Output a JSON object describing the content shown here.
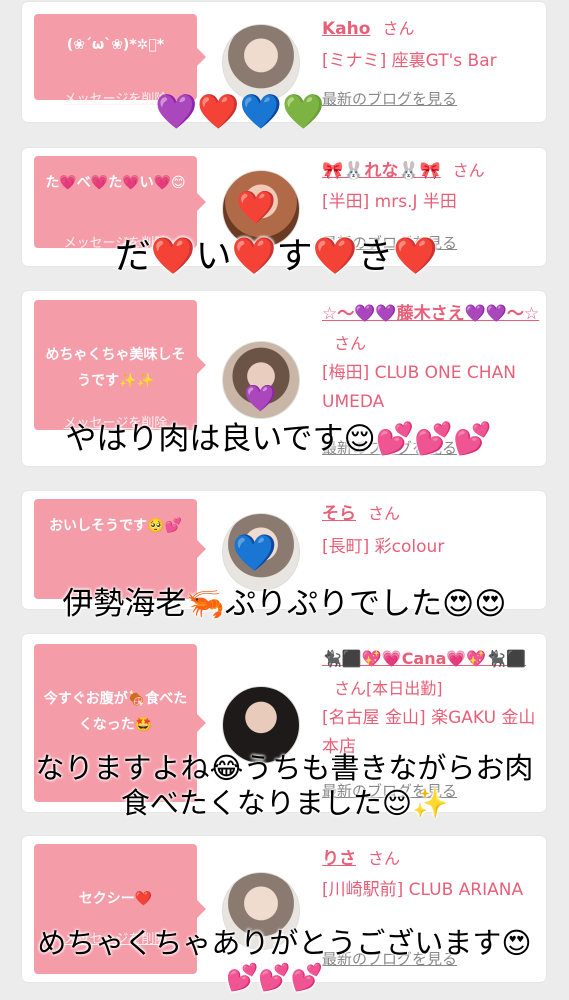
{
  "delete_label": "メッセージを削除",
  "blog_label": "最新のブログを見る",
  "san": "さん",
  "cards": [
    {
      "message": "(❀´ω`❀)*✲゚*",
      "name": "Kaho",
      "shop": "[ミナミ] 座裏GT's Bar"
    },
    {
      "message": "た💗べ💗た💗い💗😊",
      "name": "🎀🐰れな🐰🎀",
      "shop": "[半田] mrs.J 半田"
    },
    {
      "message": "めちゃくちゃ美味しそうです✨✨",
      "name": "☆〜💜💜藤木さえ💜💜〜☆",
      "shop": "[梅田] CLUB ONE CHAN UMEDA"
    },
    {
      "message": "おいしそうです🥺💕",
      "name": "そら",
      "shop": "[長町] 彩colour"
    },
    {
      "message": "今すぐお腹が🍖食べたくなった🤩",
      "name": "🐈‍⬛⬛💖💗Cana💗💖🐈‍⬛⬛",
      "name_suffix": "さん[本日出勤]",
      "shop": "[名古屋 金山] 楽GAKU 金山本店"
    },
    {
      "message": "セクシー❤️",
      "name": "りさ",
      "shop": "[川崎駅前] CLUB ARIANA"
    }
  ],
  "overlays": {
    "hearts_row": "💜❤️💙💚",
    "line1": "だ❤️い❤️す❤️き❤️",
    "line2": "やはり肉は良いです😌💕💕💕",
    "line3": "伊勢海老🦐ぷりぷりでした😍😍",
    "line4a": "なりますよね😂うちも書きながらお肉",
    "line4b": "食べたくなりました😌✨",
    "line5a": "めちゃくちゃありがとうございます😍",
    "line5b": "💕💕💕"
  },
  "avatar_stickers": {
    "card2": "❤️",
    "card3": "💜",
    "card4": "💙"
  }
}
